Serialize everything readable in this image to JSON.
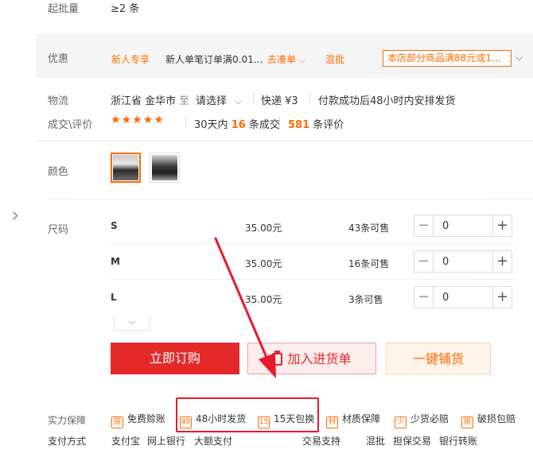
{
  "min_batch": {
    "label": "起批量",
    "value": "≥2 条"
  },
  "promo": {
    "label": "优惠",
    "tag": "新人专享",
    "desc": "新人单笔订单满0.01...",
    "combo": "去凑单",
    "mix": "混批",
    "shop_promo": "本店部分商品满88元或1..."
  },
  "logistics": {
    "label": "物流",
    "origin": "浙江省 金华市",
    "to": "至",
    "dest": "请选择",
    "express": "快递 ¥3",
    "ship_note": "付款成功后48小时内安排发货"
  },
  "deals": {
    "label": "成交\\评价",
    "stars": "★★★★★",
    "prefix": "30天内",
    "count": "16",
    "suffix": "条成交",
    "reviews": "581",
    "reviews_suffix": "条评价"
  },
  "color": {
    "label": "颜色"
  },
  "size": {
    "label": "尺码",
    "rows": [
      {
        "name": "S",
        "price": "35.00元",
        "stock": "43条可售",
        "qty": "0"
      },
      {
        "name": "M",
        "price": "35.00元",
        "stock": "16条可售",
        "qty": "0"
      },
      {
        "name": "L",
        "price": "35.00元",
        "stock": "3条可售",
        "qty": "0"
      }
    ]
  },
  "actions": {
    "buy_now": "立即订购",
    "add_to_list": "加入进货单",
    "one_click": "一键铺货"
  },
  "guarantee": {
    "label": "实力保障",
    "items": [
      {
        "icon": "赔",
        "text": "免费赊账"
      },
      {
        "icon": "48",
        "text": "48小时发货"
      },
      {
        "icon": "15",
        "text": "15天包换"
      },
      {
        "icon": "材",
        "text": "材质保障"
      },
      {
        "icon": "少",
        "text": "少货必赔"
      },
      {
        "icon": "赔",
        "text": "破损包赔"
      }
    ]
  },
  "payment": {
    "label": "支付方式",
    "methods": [
      "支付宝",
      "网上银行",
      "大额支付"
    ],
    "trade_label": "交易支持",
    "trade": [
      "混批",
      "担保交易",
      "银行转账"
    ]
  },
  "colors": {
    "accent": "#ff6a00",
    "buy": "#e4292b",
    "annotation": "#e8192c"
  }
}
